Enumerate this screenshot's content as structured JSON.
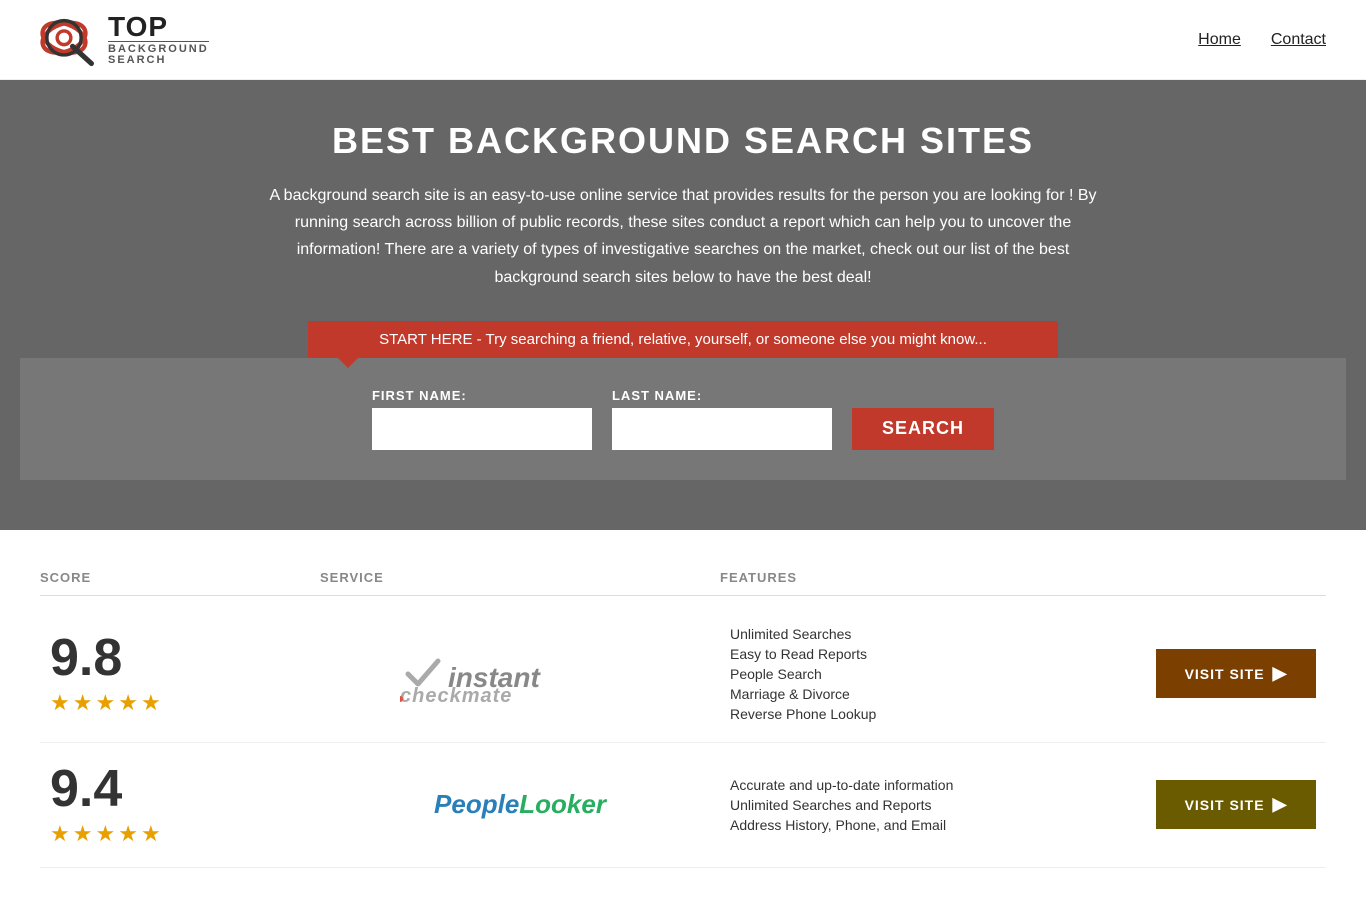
{
  "site": {
    "title": "Top Background Search"
  },
  "header": {
    "logo_top": "TOP",
    "logo_sub": "BACKGROUND\nSEARCH",
    "nav_items": [
      {
        "label": "Home",
        "href": "#"
      },
      {
        "label": "Contact",
        "href": "#"
      }
    ]
  },
  "hero": {
    "heading": "BEST BACKGROUND SEARCH SITES",
    "description": "A background search site is an easy-to-use online service that provides results  for the person you are looking for ! By  running  search across billion of public records, these sites conduct  a report which can help you to uncover the information! There are a variety of types of investigative searches on the market, check out our  list of the best background search sites below to have the best deal!",
    "banner_text": "START HERE - Try searching a friend, relative, yourself, or someone else you might know...",
    "first_name_label": "FIRST NAME:",
    "last_name_label": "LAST NAME:",
    "search_button": "SEARCH"
  },
  "table": {
    "headers": {
      "score": "SCORE",
      "service": "SERVICE",
      "features": "FEATURES"
    },
    "rows": [
      {
        "score": "9.8",
        "stars": 4.5,
        "service_name": "Instant Checkmate",
        "service_logo_type": "checkmate",
        "features": [
          "Unlimited Searches",
          "Easy to Read Reports",
          "People Search",
          "Marriage & Divorce",
          "Reverse Phone Lookup"
        ],
        "visit_label": "VISIT SITE"
      },
      {
        "score": "9.4",
        "stars": 4.5,
        "service_name": "PeopleLooker",
        "service_logo_type": "peoplelooker",
        "features": [
          "Accurate and up-to-date information",
          "Unlimited Searches and Reports",
          "Address History, Phone, and Email"
        ],
        "visit_label": "VISIT SITE"
      }
    ]
  }
}
